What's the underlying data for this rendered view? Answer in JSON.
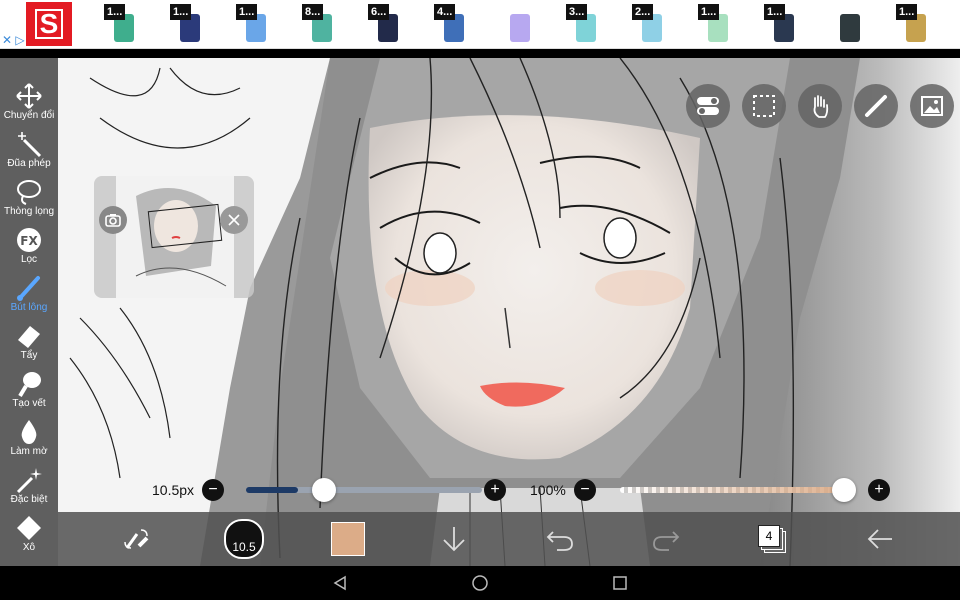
{
  "ad": {
    "logo_text": "S",
    "products": [
      {
        "badge": "1...",
        "color": "#3fae8d"
      },
      {
        "badge": "1...",
        "color": "#2b3a7a"
      },
      {
        "badge": "1...",
        "color": "#6aa6e8"
      },
      {
        "badge": "8...",
        "color": "#4fb3a0"
      },
      {
        "badge": "6...",
        "color": "#222a4a"
      },
      {
        "badge": "4...",
        "color": "#3f6fb8"
      },
      {
        "badge": "",
        "color": "#b7a8f0"
      },
      {
        "badge": "3...",
        "color": "#7fd3d8"
      },
      {
        "badge": "2...",
        "color": "#8fd0e6"
      },
      {
        "badge": "1...",
        "color": "#a8e0bf"
      },
      {
        "badge": "1...",
        "color": "#2a3850"
      },
      {
        "badge": "",
        "color": "#2f3a3e"
      },
      {
        "badge": "1...",
        "color": "#c6a24f"
      }
    ]
  },
  "toolbar": {
    "items": [
      {
        "label": "Chuyển đổi",
        "icon": "move-icon"
      },
      {
        "label": "Đũa phép",
        "icon": "magic-wand-icon"
      },
      {
        "label": "Thòng lọng",
        "icon": "lasso-icon"
      },
      {
        "label": "Lọc",
        "icon": "fx-filter-icon"
      },
      {
        "label": "Bút lông",
        "icon": "brush-icon"
      },
      {
        "label": "Tẩy",
        "icon": "eraser-icon"
      },
      {
        "label": "Tạo vết",
        "icon": "smudge-icon"
      },
      {
        "label": "Làm mờ",
        "icon": "blur-drop-icon"
      },
      {
        "label": "Đặc biệt",
        "icon": "special-sparkle-icon"
      },
      {
        "label": "Xô",
        "icon": "bucket-icon"
      }
    ],
    "active_index": 4,
    "fx_text": "FX"
  },
  "size_slider": {
    "label": "10.5px",
    "fraction": 0.22
  },
  "opacity_slider": {
    "label": "100%",
    "fraction": 1.0
  },
  "bottombar": {
    "brush_size_text": "10.5",
    "layer_count": "4",
    "color": "#dcac88"
  },
  "colors": {
    "accent": "#5aa7ff",
    "brand": "#e31b23"
  }
}
